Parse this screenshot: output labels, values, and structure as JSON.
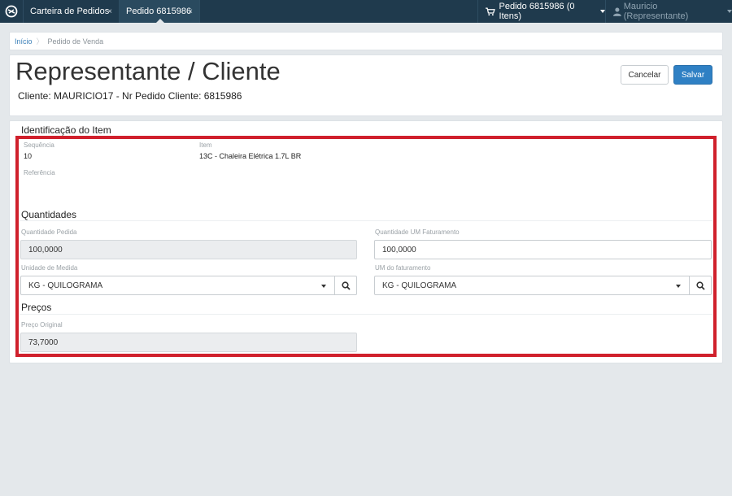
{
  "topbar": {
    "tabs": [
      {
        "label": "Carteira de Pedidos",
        "close": "×"
      },
      {
        "label": "Pedido 6815986",
        "close": "×"
      }
    ],
    "cart_label": "Pedido 6815986 (0 Itens)",
    "user_label": "Mauricio (Representante)"
  },
  "breadcrumb": {
    "home": "Início",
    "current": "Pedido de Venda"
  },
  "header": {
    "title": "Representante / Cliente",
    "subtitle": "Cliente: MAURICIO17 - Nr Pedido Cliente: 6815986",
    "cancel_label": "Cancelar",
    "save_label": "Salvar"
  },
  "item_section": {
    "title": "Identificação do Item",
    "sequence_label": "Sequência",
    "sequence_value": "10",
    "item_label": "Item",
    "item_value": "13C - Chaleira Elétrica 1.7L BR",
    "reference_label": "Referência",
    "reference_value": ""
  },
  "quantities": {
    "title": "Quantidades",
    "qty_ordered_label": "Quantidade Pedida",
    "qty_ordered_value": "100,0000",
    "qty_billing_label": "Quantidade UM Faturamento",
    "qty_billing_value": "100,0000",
    "unit_label": "Unidade de Medida",
    "unit_value": "KG - QUILOGRAMA",
    "billing_unit_label": "UM do faturamento",
    "billing_unit_value": "KG - QUILOGRAMA"
  },
  "prices": {
    "title": "Preços",
    "original_price_label": "Preço Original",
    "original_price_value": "73,7000"
  },
  "colors": {
    "topbar": "#1f3a4d",
    "primary_button": "#2f80c4",
    "highlight_border": "#d0202c",
    "link": "#3a7fb8"
  }
}
